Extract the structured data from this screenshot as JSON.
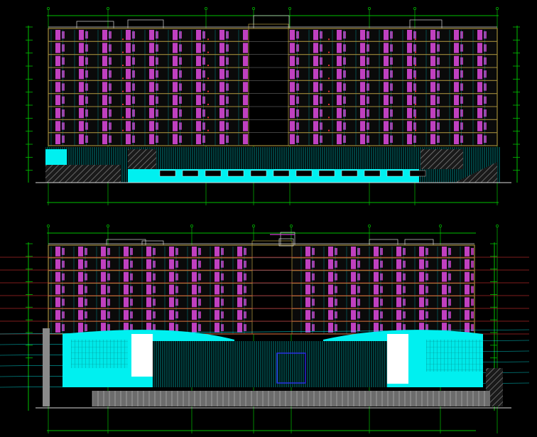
{
  "drawing": {
    "background": "#000000",
    "elevation_top": {
      "caption": "",
      "floors": 9
    },
    "elevation_bottom": {
      "caption": "",
      "floors": 7
    }
  },
  "colors": {
    "window_band": "#c040c0",
    "facade_line": "#a08a3a",
    "glass": "#00f0f0",
    "dimension": "#00c000",
    "level_red": "#e03030",
    "hatch": "#8a8a8a",
    "white_line": "#d8d8d8"
  }
}
